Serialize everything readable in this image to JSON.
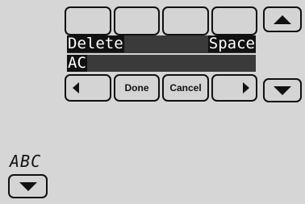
{
  "keyboard": {
    "top_keys": [
      "",
      "",
      "",
      ""
    ],
    "delete_label": "Delete",
    "space_label": "Space",
    "text_value": "AC",
    "done_label": "Done",
    "cancel_label": "Cancel"
  },
  "mode_indicator": "ABC",
  "icons": {
    "scroll_up": "up-triangle-icon",
    "scroll_down": "down-triangle-icon",
    "cursor_left": "left-triangle-icon",
    "cursor_right": "right-triangle-icon",
    "mode_toggle": "down-triangle-icon"
  },
  "colors": {
    "background": "#d6d6d6",
    "bar": "#3a3a3a",
    "highlight": "#111111",
    "text_light": "#ffffff"
  }
}
